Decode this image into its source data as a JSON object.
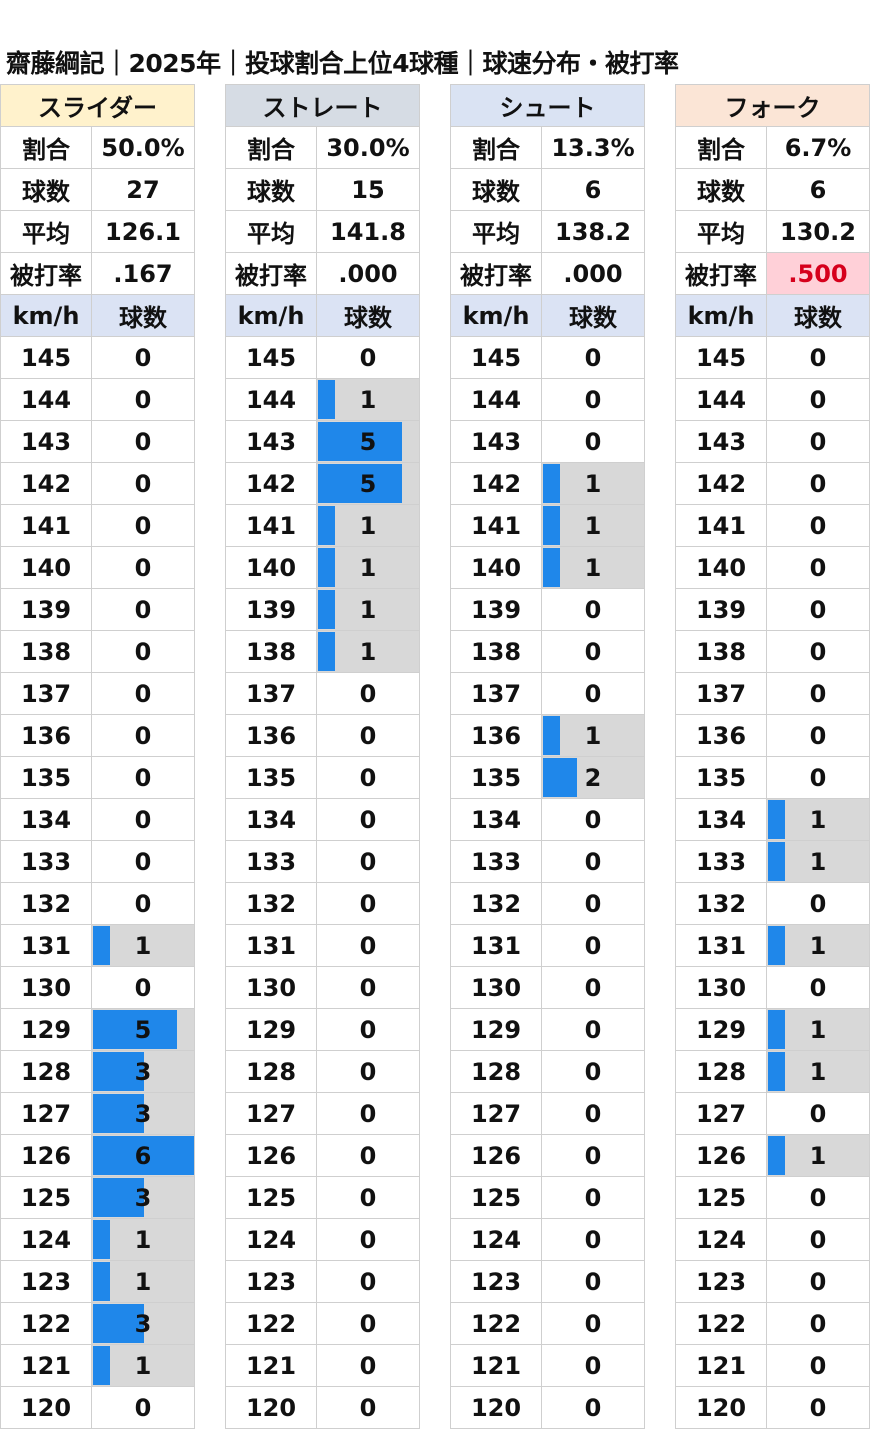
{
  "title": "齋藤綱記｜2025年｜投球割合上位4球種｜球速分布・被打率",
  "labels": {
    "ratio": "割合",
    "count": "球数",
    "avg": "平均",
    "bavg": "被打率",
    "kmh": "km/h",
    "pitches": "球数"
  },
  "colors": {
    "bar": "#1f87ea",
    "bar_bg": "#d8d8d8",
    "alert_bg": "#ffd0d8",
    "alert_text": "#d6001c"
  },
  "chart_data": {
    "type": "table",
    "speeds": [
      145,
      144,
      143,
      142,
      141,
      140,
      139,
      138,
      137,
      136,
      135,
      134,
      133,
      132,
      131,
      130,
      129,
      128,
      127,
      126,
      125,
      124,
      123,
      122,
      121,
      120
    ],
    "max_count": 6,
    "pitches": [
      {
        "name": "スライダー",
        "header_color": "#fff2cc",
        "ratio": "50.0%",
        "count": "27",
        "avg": "126.1",
        "bavg": ".167",
        "bavg_alert": false,
        "counts": [
          0,
          0,
          0,
          0,
          0,
          0,
          0,
          0,
          0,
          0,
          0,
          0,
          0,
          0,
          1,
          0,
          5,
          3,
          3,
          6,
          3,
          1,
          1,
          3,
          1,
          0
        ]
      },
      {
        "name": "ストレート",
        "header_color": "#d6dce4",
        "ratio": "30.0%",
        "count": "15",
        "avg": "141.8",
        "bavg": ".000",
        "bavg_alert": false,
        "counts": [
          0,
          1,
          5,
          5,
          1,
          1,
          1,
          1,
          0,
          0,
          0,
          0,
          0,
          0,
          0,
          0,
          0,
          0,
          0,
          0,
          0,
          0,
          0,
          0,
          0,
          0
        ]
      },
      {
        "name": "シュート",
        "header_color": "#dae3f3",
        "ratio": "13.3%",
        "count": "6",
        "avg": "138.2",
        "bavg": ".000",
        "bavg_alert": false,
        "counts": [
          0,
          0,
          0,
          1,
          1,
          1,
          0,
          0,
          0,
          1,
          2,
          0,
          0,
          0,
          0,
          0,
          0,
          0,
          0,
          0,
          0,
          0,
          0,
          0,
          0,
          0
        ]
      },
      {
        "name": "フォーク",
        "header_color": "#fbe5d6",
        "ratio": "6.7%",
        "count": "6",
        "avg": "130.2",
        "bavg": ".500",
        "bavg_alert": true,
        "counts": [
          0,
          0,
          0,
          0,
          0,
          0,
          0,
          0,
          0,
          0,
          0,
          1,
          1,
          0,
          1,
          0,
          1,
          1,
          0,
          1,
          0,
          0,
          0,
          0,
          0,
          0
        ]
      }
    ]
  }
}
